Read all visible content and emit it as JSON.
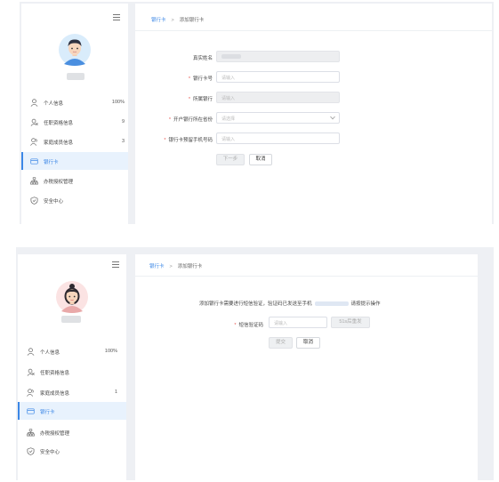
{
  "screen1": {
    "breadcrumb": {
      "parent": "银行卡",
      "separator": ">",
      "current": "添加银行卡"
    },
    "nav": [
      {
        "label": "个人信息",
        "count": "100%",
        "icon": "user-icon"
      },
      {
        "label": "任职资格信息",
        "count": "9",
        "icon": "certificate-icon"
      },
      {
        "label": "家庭成员信息",
        "count": "3",
        "icon": "family-icon"
      },
      {
        "label": "银行卡",
        "count": "",
        "icon": "card-icon",
        "active": true
      },
      {
        "label": "办税授权管理",
        "count": "",
        "icon": "org-icon"
      },
      {
        "label": "安全中心",
        "count": "",
        "icon": "shield-icon"
      }
    ],
    "form": {
      "name_label": "真实姓名",
      "card_label": "银行卡号",
      "card_placeholder": "请输入",
      "bank_label": "所属银行",
      "bank_placeholder": "请输入",
      "region_label": "开户银行所在省份",
      "region_placeholder": "请选择",
      "phone_label": "银行卡预留手机号码",
      "phone_placeholder": "请输入",
      "next_label": "下一步",
      "cancel_label": "取消"
    }
  },
  "screen2": {
    "breadcrumb": {
      "parent": "银行卡",
      "separator": ">",
      "current": "添加银行卡"
    },
    "nav": [
      {
        "label": "个人信息",
        "count": "100%",
        "icon": "user-icon"
      },
      {
        "label": "任职资格信息",
        "count": "",
        "icon": "certificate-icon"
      },
      {
        "label": "家庭成员信息",
        "count": "1",
        "icon": "family-icon"
      },
      {
        "label": "银行卡",
        "count": "",
        "icon": "card-icon",
        "active": true
      },
      {
        "label": "办税授权管理",
        "count": "",
        "icon": "org-icon"
      },
      {
        "label": "安全中心",
        "count": "",
        "icon": "shield-icon"
      }
    ],
    "notice_prefix": "添加银行卡需要进行短信验证，验证码已发送至手机",
    "notice_suffix": "请按提示操作",
    "sms_label": "短信验证码",
    "sms_placeholder": "请输入",
    "resend_label": "51s后重发",
    "submit_label": "提交",
    "cancel_label": "取消"
  },
  "colors": {
    "accent": "#3b87e6",
    "required": "#e8554e",
    "active_bg": "#e8f2fd"
  }
}
